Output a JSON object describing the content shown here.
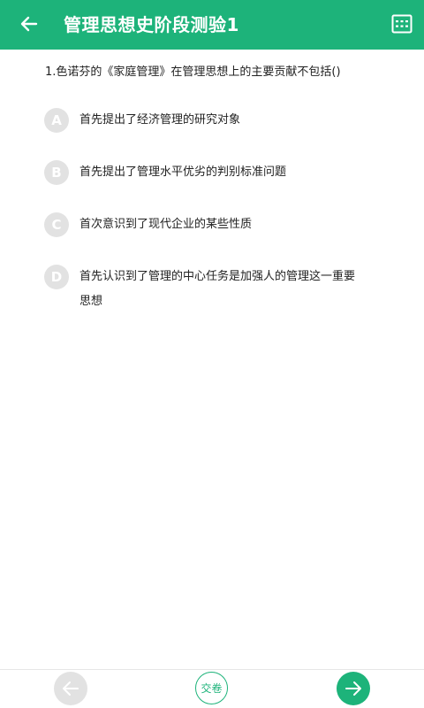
{
  "header": {
    "title": "管理思想史阶段测验1",
    "back_icon": "arrow-left-icon",
    "card_icon": "answer-card-icon",
    "bg_color": "#1db37a"
  },
  "question": {
    "text": "1.色诺芬的《家庭管理》在管理思想上的主要贡献不包括()",
    "options": [
      {
        "letter": "A",
        "text": "首先提出了经济管理的研究对象"
      },
      {
        "letter": "B",
        "text": "首先提出了管理水平优劣的判别标准问题"
      },
      {
        "letter": "C",
        "text": "首次意识到了现代企业的某些性质"
      },
      {
        "letter": "D",
        "text": "首先认识到了管理的中心任务是加强人的管理这一重要思想"
      }
    ]
  },
  "footer": {
    "prev_icon": "arrow-left-icon",
    "submit_label": "交卷",
    "next_icon": "arrow-right-icon"
  }
}
